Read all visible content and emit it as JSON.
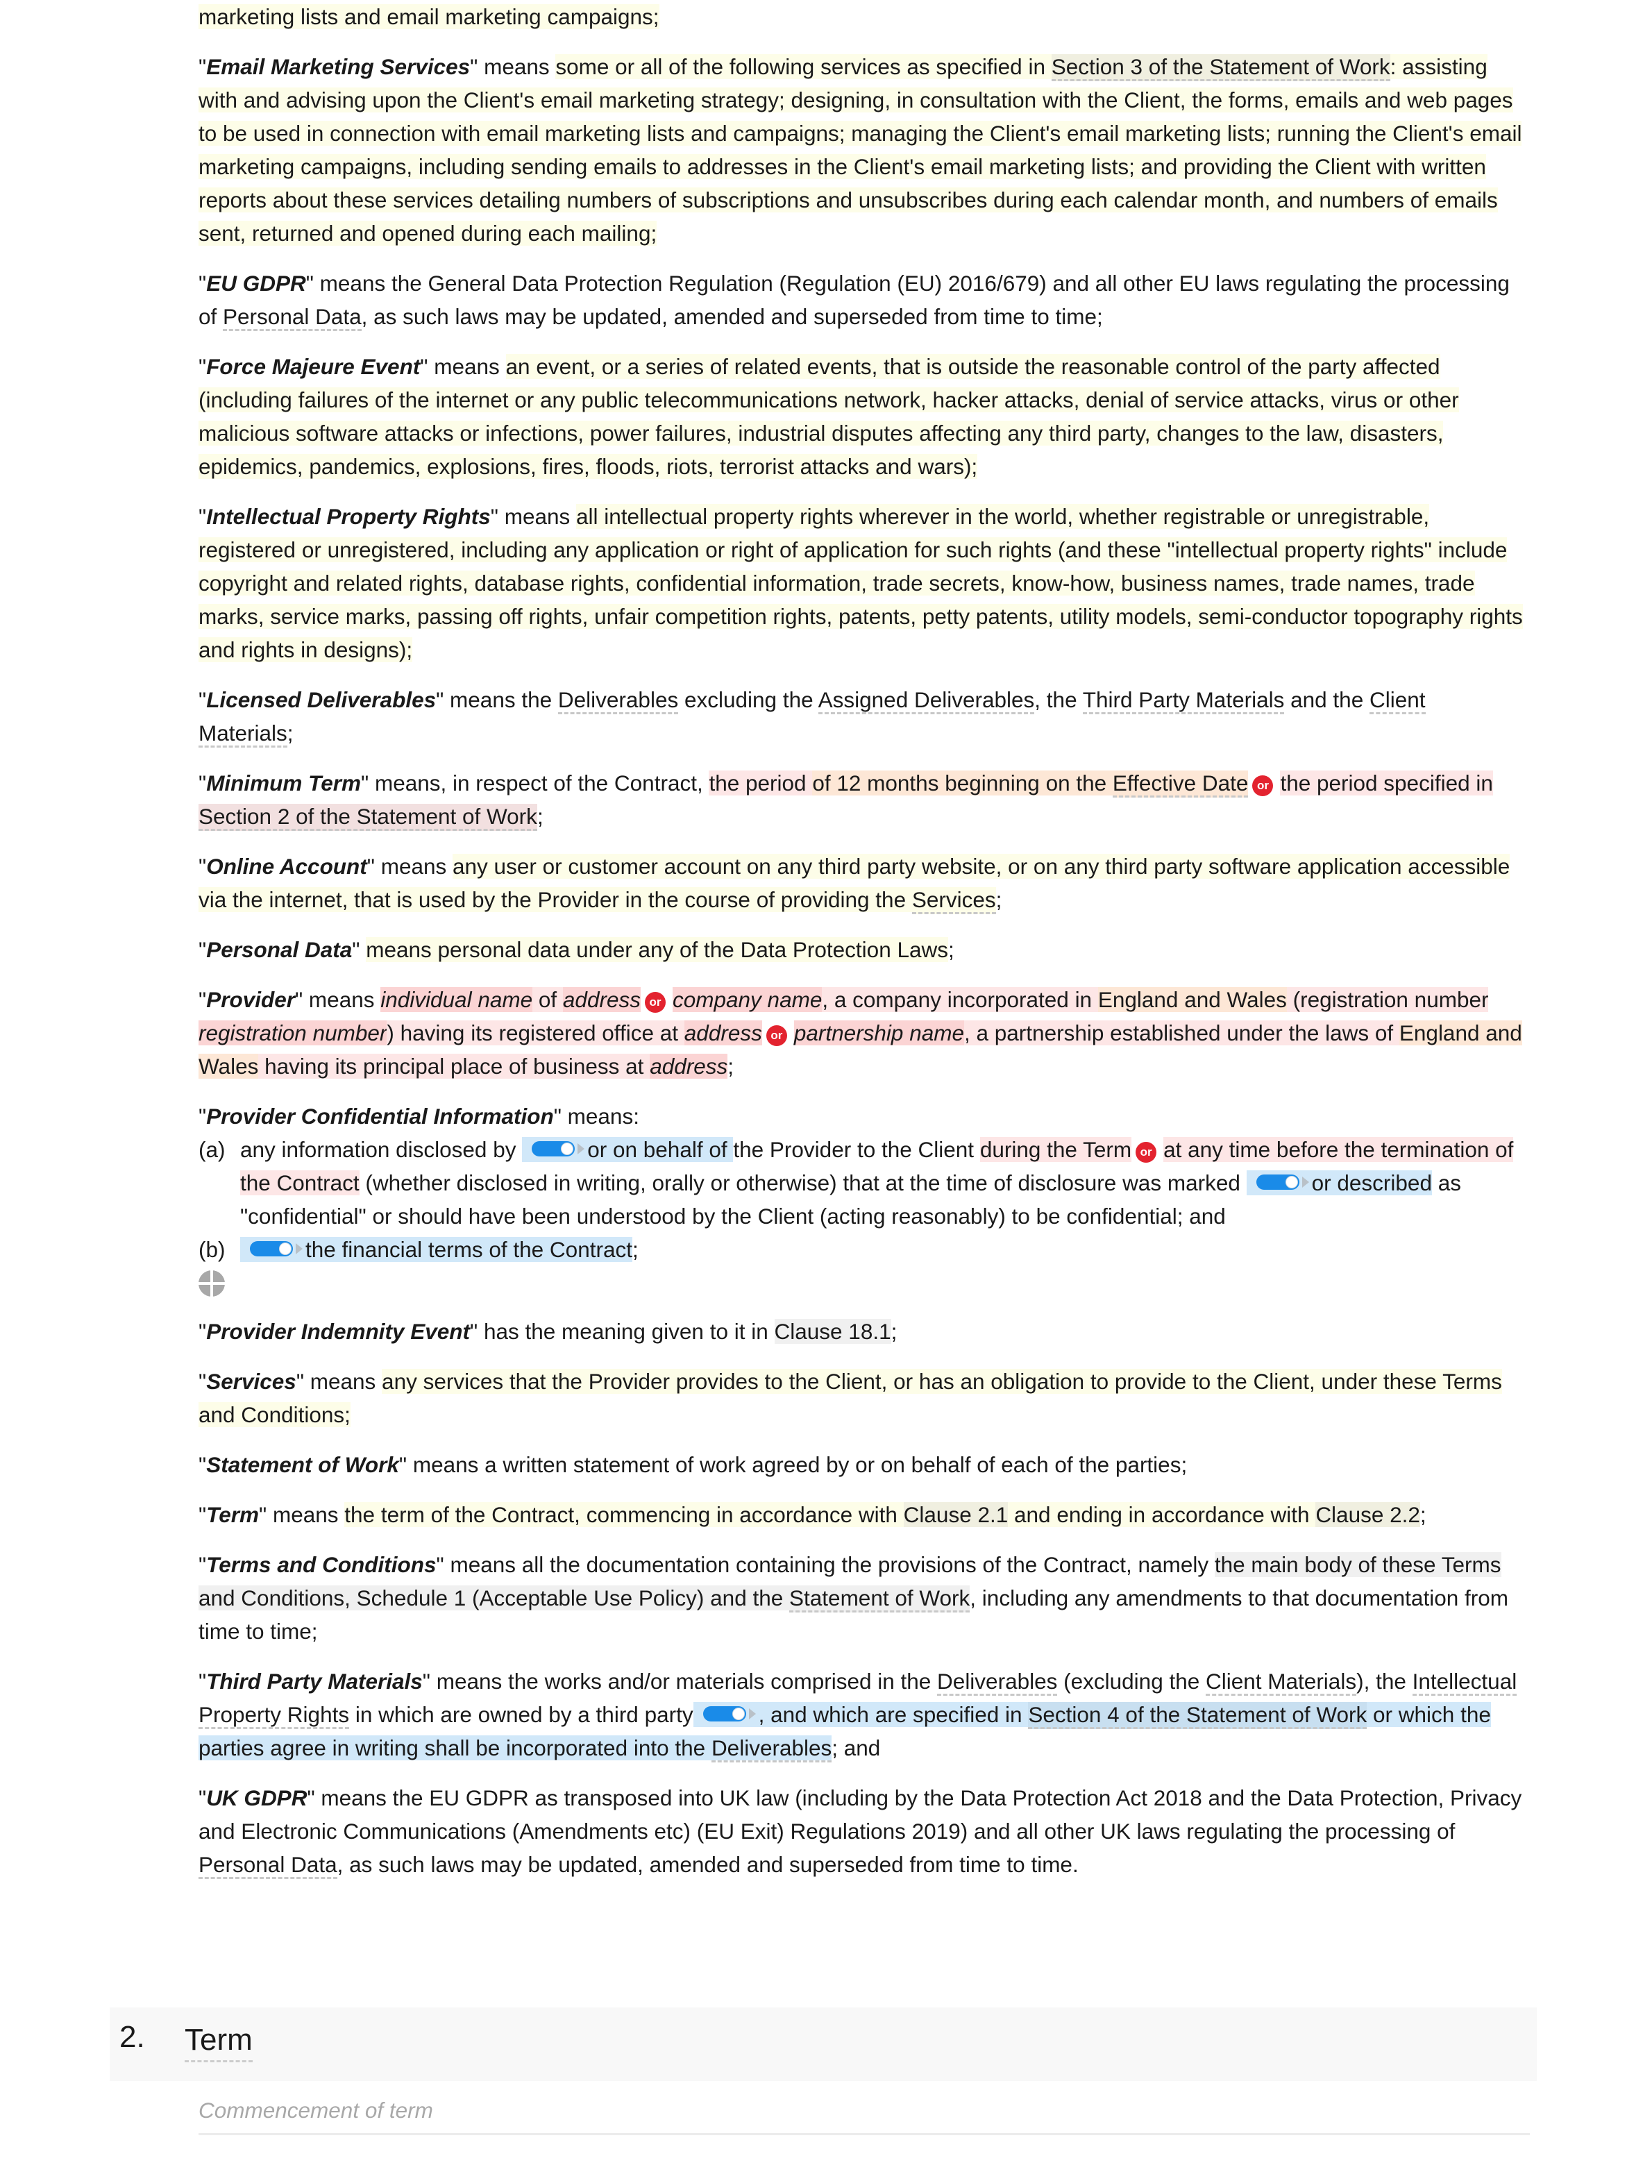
{
  "definitions": {
    "email_marketing_tail": "marketing lists and email marketing campaigns;",
    "email_marketing": {
      "term": "Email Marketing Services",
      "means": "\" means ",
      "text1": "some or all of the following services as specified in ",
      "xref": "Section 3 of the Statement of Work",
      "text2": ": assisting with and advising upon the Client's email marketing strategy; designing, in consultation with the Client, the forms, emails and web pages to be used in connection with email marketing lists and campaigns; managing the Client's email marketing lists; running the Client's email marketing campaigns, including sending emails to addresses in the Client's email marketing lists; and providing the Client with written reports about these services detailing numbers of subscriptions and unsubscribes during each calendar month, and numbers of emails sent, returned and opened during each mailing;"
    },
    "eu_gdpr": {
      "term": "EU GDPR",
      "text1": "\" means the General Data Protection Regulation (Regulation (EU) 2016/679) and all other EU laws regulating the processing of ",
      "xref": "Personal Data",
      "text2": ", as such laws may be updated, amended and superseded from time to time;"
    },
    "force_majeure": {
      "term": "Force Majeure Event",
      "means": "\" means ",
      "text": "an event, or a series of related events, that is outside the reasonable control of the party affected (including failures of the internet or any public telecommunications network, hacker attacks, denial of service attacks, virus or other malicious software attacks or infections, power failures, industrial disputes affecting any third party, changes to the law, disasters, epidemics, pandemics, explosions, fires, floods, riots, terrorist attacks and wars);"
    },
    "ipr": {
      "term": "Intellectual Property Rights",
      "means": "\" means ",
      "text": "all intellectual property rights wherever in the world, whether registrable or unregistrable, registered or unregistered, including any application or right of application for such rights (and these \"intellectual property rights\" include copyright and related rights, database rights, confidential information, trade secrets, know-how, business names, trade names, trade marks, service marks, passing off rights, unfair competition rights, patents, petty patents, utility models, semi-conductor topography rights and rights in designs);"
    },
    "licensed_deliverables": {
      "term": "Licensed Deliverables",
      "text1": "\" means the ",
      "xref1": "Deliverables",
      "text2": " excluding the ",
      "xref2": "Assigned Deliverables",
      "text3": ", the ",
      "xref3": "Third Party Materials",
      "text4": " and the ",
      "xref4": "Client Materials",
      "text5": ";"
    },
    "minimum_term": {
      "term": "Minimum Term",
      "text1": "\" means, in respect of the Contract, ",
      "opt1a": "the period ",
      "opt1b": "of 12 months beginning on the ",
      "opt1_xref": "Effective Date",
      "or": "or",
      "opt2a": "the period specified in ",
      "opt2_xref": "Section 2 of the Statement of Work",
      "text2": ";"
    },
    "online_account": {
      "term": "Online Account",
      "means": "\" means ",
      "text": "any user or customer account on any third party website, or on any third party software application accessible via the internet, that is used by the Provider in the course of providing the ",
      "xref": "Services",
      "text2": ";"
    },
    "personal_data": {
      "term": "Personal Data",
      "means": "\" ",
      "text": "means personal data under any of the ",
      "xref": "Data Protection Laws",
      "text2": ";"
    },
    "provider": {
      "term": "Provider",
      "means": "\" means ",
      "var_individual_name": "individual name",
      "of": " of ",
      "var_address1": "address",
      "or": "or",
      "var_company_name": "company name",
      "text_company": ", a company incorporated in ",
      "england_wales1": "England and Wales",
      "text_reg": " (registration number ",
      "var_reg_number": "registration number",
      "text_office": ") having its registered office at ",
      "var_address2": "address",
      "var_partnership_name": "partnership name",
      "text_partnership": ", a partnership established under the laws of ",
      "england_wales2": "England and Wales",
      "text_place": " having its principal place of business at ",
      "var_address3": "address",
      "end": ";"
    },
    "provider_ci": {
      "term": "Provider Confidential Information",
      "means": "\" means:",
      "a_label": "(a)",
      "a_text1": "any information disclosed by ",
      "a_opt1": "or on behalf of ",
      "a_text2": "the Provider to the Client ",
      "a_during": "during the Term",
      "or": "or",
      "a_anytime": "at any time before the termination of the Contract",
      "a_text3": " (whether disclosed in writing, orally or otherwise) that at the time of disclosure was marked ",
      "a_opt2": "or described",
      "a_text4": " as \"confidential\" or should have been understood by the Client (acting reasonably) to be confidential; and",
      "b_label": "(b)",
      "b_text": "the financial terms of the Contract",
      "b_end": ";"
    },
    "provider_indemnity": {
      "term": "Provider Indemnity Event",
      "text1": "\" has the meaning given to it in ",
      "xref": "Clause 18.1",
      "text2": ";"
    },
    "services": {
      "term": "Services",
      "means": "\" means ",
      "text": "any services that the Provider provides to the Client, or has an obligation to provide to the Client, under these Terms and Conditions;"
    },
    "statement_of_work": {
      "term": "Statement of Work",
      "text": "\" means a written statement of work agreed by or on behalf of each of the parties;"
    },
    "term_def": {
      "term": "Term",
      "means": "\" means ",
      "text1": "the term of the Contract, commencing in accordance with ",
      "xref1": "Clause 2.1",
      "text2": " and ending in accordance with ",
      "xref2": "Clause 2.2",
      "end": ";"
    },
    "terms_conditions": {
      "term": "Terms and Conditions",
      "text1": "\" means all the documentation containing the provisions of the Contract, namely ",
      "grey": "the main body of these Terms and Conditions, Schedule 1 (Acceptable Use Policy) and the ",
      "xref": "Statement of Work",
      "text2": ", including any amendments to that documentation from time to time;"
    },
    "third_party_materials": {
      "term": "Third Party Materials",
      "text1": "\" means the works and/or materials comprised in the ",
      "xref1": "Deliverables",
      "text2": " (excluding the ",
      "xref2": "Client Materials",
      "text3": "), the ",
      "xref3": "Intellectual Property Rights",
      "text4": " in which are owned by a third party",
      "opt_text": ", and which are specified in ",
      "opt_xref": "Section 4 of the Statement of Work",
      "opt_text2": " or which the parties agree in writing shall be incorporated into the ",
      "opt_xref2": "Deliverables",
      "end": "; and"
    },
    "uk_gdpr": {
      "term": "UK GDPR",
      "text1": "\" means the EU GDPR as transposed into UK law (including by the Data Protection Act 2018 and the Data Protection, Privacy and Electronic Communications (Amendments etc) (EU Exit) Regulations 2019) and all other UK laws regulating the processing of ",
      "xref": "Personal Data",
      "text2": ", as such laws may be updated, amended and superseded from time to time."
    }
  },
  "quote": "\"",
  "section": {
    "number": "2.",
    "title": "Term",
    "subheading": "Commencement of term"
  },
  "colors": {
    "optional_highlight": "#fdfde8",
    "alternative_highlight": "#fde6e6",
    "variable_highlight": "#fbd4d4",
    "toggle_highlight": "#d1e8f9",
    "or_badge": "#e3232f",
    "toggle_on": "#1a8be8"
  }
}
